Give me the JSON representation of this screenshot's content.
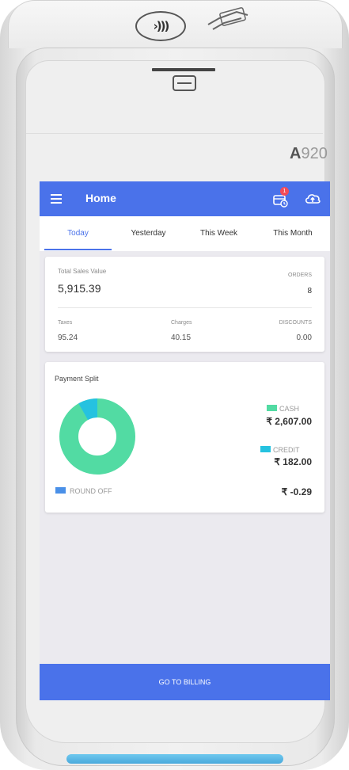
{
  "device": {
    "model_prefix": "A",
    "model_number": "920"
  },
  "header": {
    "title": "Home",
    "notification_count": "1",
    "menu_icon": "hamburger-menu-icon",
    "orders_icon": "orders-icon",
    "sync_icon": "cloud-upload-icon",
    "accent_color": "#4a72ea"
  },
  "tabs": [
    {
      "label": "Today",
      "active": true
    },
    {
      "label": "Yesterday",
      "active": false
    },
    {
      "label": "This Week",
      "active": false
    },
    {
      "label": "This Month",
      "active": false
    }
  ],
  "sales": {
    "total_label": "Total Sales Value",
    "total_value": "5,915.39",
    "orders_label": "ORDERS",
    "orders_value": "8",
    "taxes_label": "Taxes",
    "taxes_value": "95.24",
    "charges_label": "Charges",
    "charges_value": "40.15",
    "discounts_label": "DISCOUNTS",
    "discounts_value": "0.00"
  },
  "payment_split": {
    "title": "Payment Split",
    "items": [
      {
        "name": "CASH",
        "amount": "₹ 2,607.00",
        "color": "#52dba3"
      },
      {
        "name": "CREDIT",
        "amount": "₹ 182.00",
        "color": "#25c2e0"
      }
    ],
    "round_off": {
      "name": "ROUND OFF",
      "amount": "₹ -0.29",
      "color": "#4a90e8"
    }
  },
  "footer": {
    "billing_button": "GO TO BILLING"
  }
}
